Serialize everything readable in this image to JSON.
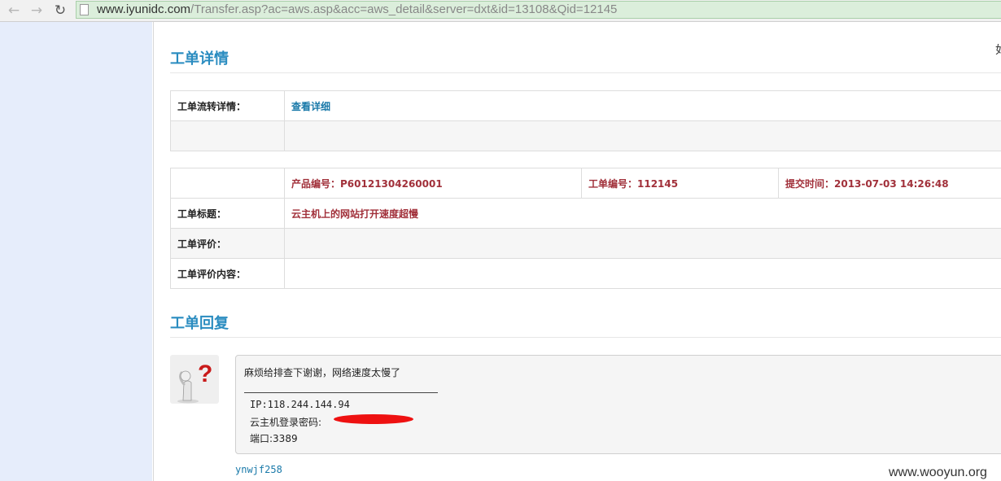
{
  "browser": {
    "back_icon": "←",
    "forward_icon": "→",
    "reload_icon": "↻",
    "url_host": "www.iyunidc.com",
    "url_path": "/Transfer.asp?ac=aws.asp&acc=aws_detail&server=dxt&id=13108&Qid=12145"
  },
  "page": {
    "topright_text": "如",
    "detail_title": "工单详情",
    "flow_label": "工单流转详情：",
    "flow_link": "查看详细",
    "product_no": "产品编号：P60121304260001",
    "ticket_no": "工单编号：112145",
    "submit_time": "提交时间：2013-07-03 14:26:48",
    "title_label": "工单标题：",
    "title_value": "云主机上的网站打开速度超慢",
    "rating_label": "工单评价：",
    "rating_content_label": "工单评价内容：",
    "reply_title": "工单回复",
    "reply_message": "麻烦给排查下谢谢，网络速度太慢了",
    "ip_line": "IP:118.244.144.94",
    "password_label": "云主机登录密码:",
    "port_line": "端口:3389",
    "reply_user": "ynwjf258"
  },
  "watermark": "www.wooyun.org",
  "colors": {
    "accent": "#2a8cc0",
    "link": "#1979a9",
    "red_text": "#a1303a",
    "sidebar": "#e6edfb",
    "urlbar": "#dbeedb"
  }
}
